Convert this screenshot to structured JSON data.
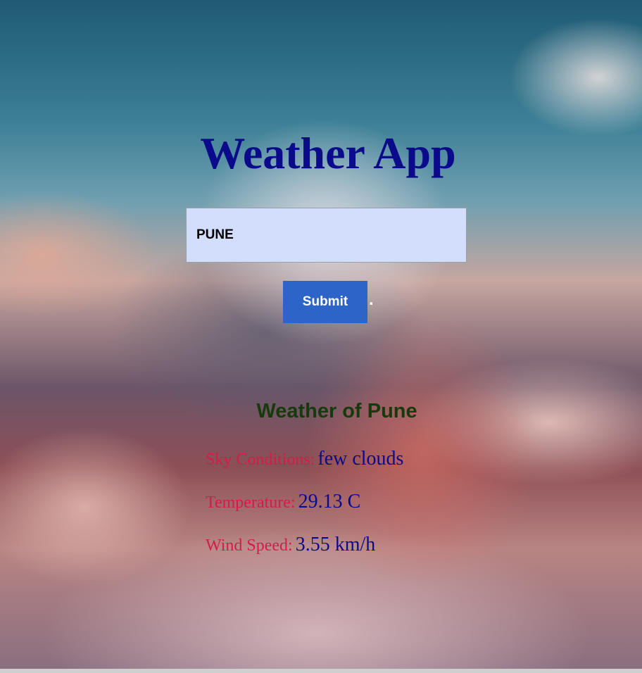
{
  "app": {
    "title": "Weather App"
  },
  "search": {
    "value": "PUNE",
    "submit_label": "Submit",
    "trailing_text": "."
  },
  "result": {
    "heading": "Weather of Pune",
    "sky": {
      "label": "Sky Conditions:",
      "value": "few clouds"
    },
    "temperature": {
      "label": "Temperature:",
      "value": "29.13 C"
    },
    "wind": {
      "label": "Wind Speed:",
      "value": "3.55 km/h"
    }
  },
  "colors": {
    "title": "#0a0a8a",
    "label": "#d21c4a",
    "value": "#0a0a8a",
    "heading": "#173a0c",
    "button": "#2c64c8",
    "input_bg": "#d3defc"
  }
}
